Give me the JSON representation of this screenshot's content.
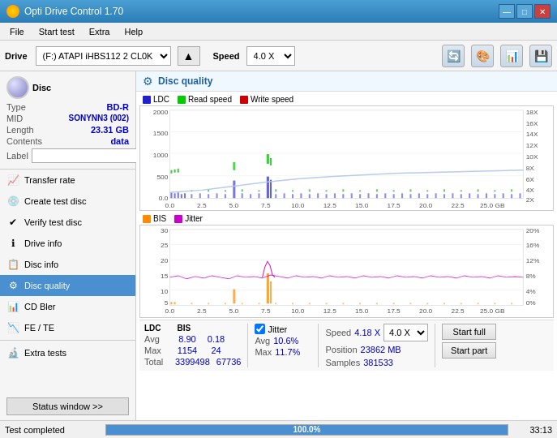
{
  "window": {
    "title": "Opti Drive Control 1.70",
    "icon": "disc-icon"
  },
  "window_controls": {
    "minimize": "—",
    "maximize": "□",
    "close": "✕"
  },
  "menu": {
    "items": [
      "File",
      "Start test",
      "Extra",
      "Help"
    ]
  },
  "toolbar": {
    "drive_label": "Drive",
    "drive_value": "(F:) ATAPI iHBS112  2 CL0K",
    "speed_label": "Speed",
    "speed_value": "4.0 X",
    "eject_icon": "▲"
  },
  "disc": {
    "section_label": "Disc",
    "type_label": "Type",
    "type_value": "BD-R",
    "mid_label": "MID",
    "mid_value": "SONYNN3 (002)",
    "length_label": "Length",
    "length_value": "23.31 GB",
    "contents_label": "Contents",
    "contents_value": "data",
    "label_label": "Label",
    "label_placeholder": ""
  },
  "nav": {
    "items": [
      {
        "id": "transfer-rate",
        "label": "Transfer rate",
        "icon": "📈"
      },
      {
        "id": "create-test-disc",
        "label": "Create test disc",
        "icon": "💿"
      },
      {
        "id": "verify-test-disc",
        "label": "Verify test disc",
        "icon": "✔"
      },
      {
        "id": "drive-info",
        "label": "Drive info",
        "icon": "ℹ"
      },
      {
        "id": "disc-info",
        "label": "Disc info",
        "icon": "📋"
      },
      {
        "id": "disc-quality",
        "label": "Disc quality",
        "icon": "⚙",
        "active": true
      },
      {
        "id": "cd-bler",
        "label": "CD Bler",
        "icon": "📊"
      },
      {
        "id": "fe-te",
        "label": "FE / TE",
        "icon": "📉"
      },
      {
        "id": "extra-tests",
        "label": "Extra tests",
        "icon": "🔬"
      }
    ],
    "status_window_btn": "Status window >>"
  },
  "disc_quality": {
    "title": "Disc quality",
    "icon": "⚙",
    "legend": {
      "ldc": {
        "label": "LDC",
        "color": "#2020cc"
      },
      "read_speed": {
        "label": "Read speed",
        "color": "#00cc00"
      },
      "write_speed": {
        "label": "Write speed",
        "color": "#cc0000"
      }
    },
    "legend2": {
      "bis": {
        "label": "BIS",
        "color": "#ff8c00"
      },
      "jitter": {
        "label": "Jitter",
        "color": "#cc00cc"
      }
    },
    "chart1": {
      "y_max": 2000,
      "y_labels": [
        "2000",
        "1500",
        "1000",
        "500",
        "0.0"
      ],
      "x_labels": [
        "0.0",
        "2.5",
        "5.0",
        "7.5",
        "10.0",
        "12.5",
        "15.0",
        "17.5",
        "20.0",
        "22.5",
        "25.0 GB"
      ],
      "y_right_labels": [
        "18X",
        "16X",
        "14X",
        "12X",
        "10X",
        "8X",
        "6X",
        "4X",
        "2X"
      ]
    },
    "chart2": {
      "y_labels": [
        "30",
        "25",
        "20",
        "15",
        "10",
        "5",
        "0.0"
      ],
      "x_labels": [
        "0.0",
        "2.5",
        "5.0",
        "7.5",
        "10.0",
        "12.5",
        "15.0",
        "17.5",
        "20.0",
        "22.5",
        "25.0 GB"
      ],
      "y_right_labels": [
        "20%",
        "16%",
        "12%",
        "8%",
        "4%",
        "0%"
      ]
    }
  },
  "stats": {
    "ldc_header": "LDC",
    "bis_header": "BIS",
    "jitter_label": "✔ Jitter",
    "avg_label": "Avg",
    "max_label": "Max",
    "total_label": "Total",
    "ldc_avg": "8.90",
    "ldc_max": "1154",
    "ldc_total": "3399498",
    "bis_avg": "0.18",
    "bis_max": "24",
    "bis_total": "67736",
    "jitter_avg": "10.6%",
    "jitter_max": "11.7%",
    "jitter_total": "",
    "speed_label": "Speed",
    "speed_value": "4.18 X",
    "speed_select": "4.0 X",
    "position_label": "Position",
    "position_value": "23862 MB",
    "samples_label": "Samples",
    "samples_value": "381533",
    "start_full_btn": "Start full",
    "start_part_btn": "Start part"
  },
  "status_bar": {
    "text": "Test completed",
    "progress": "100.0%",
    "time": "33:13"
  }
}
